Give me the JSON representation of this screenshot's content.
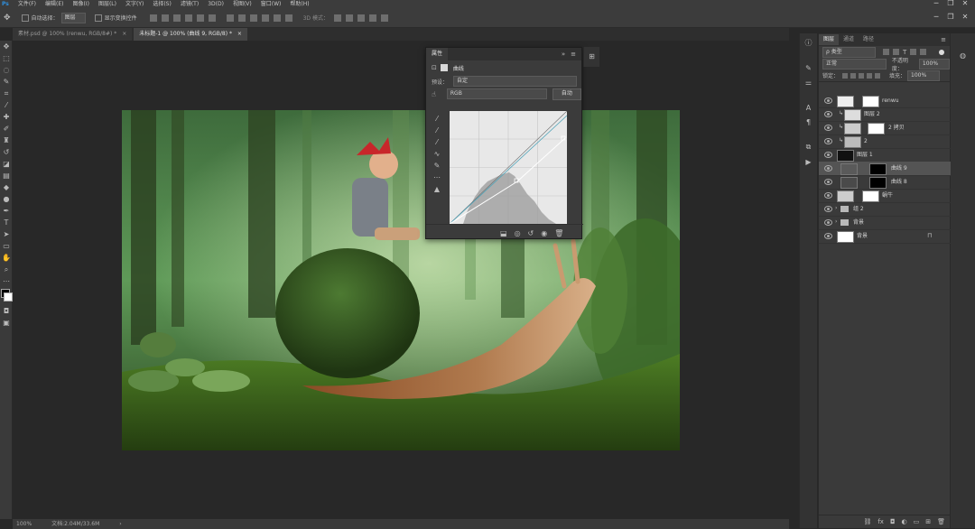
{
  "menu": {
    "items": [
      "文件(F)",
      "编辑(E)",
      "图像(I)",
      "图层(L)",
      "文字(Y)",
      "选择(S)",
      "滤镜(T)",
      "3D(D)",
      "视图(V)",
      "窗口(W)",
      "帮助(H)"
    ]
  },
  "options": {
    "auto_select_label": "自动选择：",
    "auto_select_value": "图层",
    "show_transform_label": "显示变换控件",
    "mode_3d_label": "3D 模式："
  },
  "tabs": [
    {
      "label": "素材.psd @ 100% (renwu, RGB/8#) *",
      "close": "×"
    },
    {
      "label": "未标题-1 @ 100% (曲线 9, RGB/8) *",
      "close": "×"
    }
  ],
  "properties": {
    "tab_label": "属性",
    "title": "曲线",
    "preset_label": "预设：",
    "preset_value": "自定",
    "channel_value": "RGB",
    "auto_button": "自动"
  },
  "layers_panel": {
    "tabs": [
      "图层",
      "通道",
      "路径"
    ],
    "kind_filter": "ρ 类型",
    "blend_mode": "正常",
    "opacity_label": "不透明度：",
    "opacity_value": "100%",
    "lock_label": "锁定：",
    "fill_label": "填充：",
    "fill_value": "100%",
    "layers": [
      {
        "name": "renwu",
        "kind": "smart-mask"
      },
      {
        "name": "图层 2",
        "kind": "clip"
      },
      {
        "name": "2 拷贝",
        "kind": "smart-mask"
      },
      {
        "name": "2",
        "kind": "clip"
      },
      {
        "name": "图层 1",
        "kind": "clip"
      },
      {
        "name": "曲线 9",
        "kind": "adjust",
        "selected": true
      },
      {
        "name": "曲线 8",
        "kind": "adjust"
      },
      {
        "name": "蜗牛",
        "kind": "smart-mask"
      },
      {
        "name": "组 2",
        "kind": "group"
      },
      {
        "name": "背景",
        "kind": "group"
      },
      {
        "name": "背景",
        "kind": "background"
      }
    ]
  },
  "status": {
    "zoom": "100%",
    "doc_info": "文档:2.04M/33.6M"
  },
  "colors": {
    "ui_bg": "#3a3a3a",
    "canvas_bg": "#282828",
    "selected_layer": "#545454"
  }
}
